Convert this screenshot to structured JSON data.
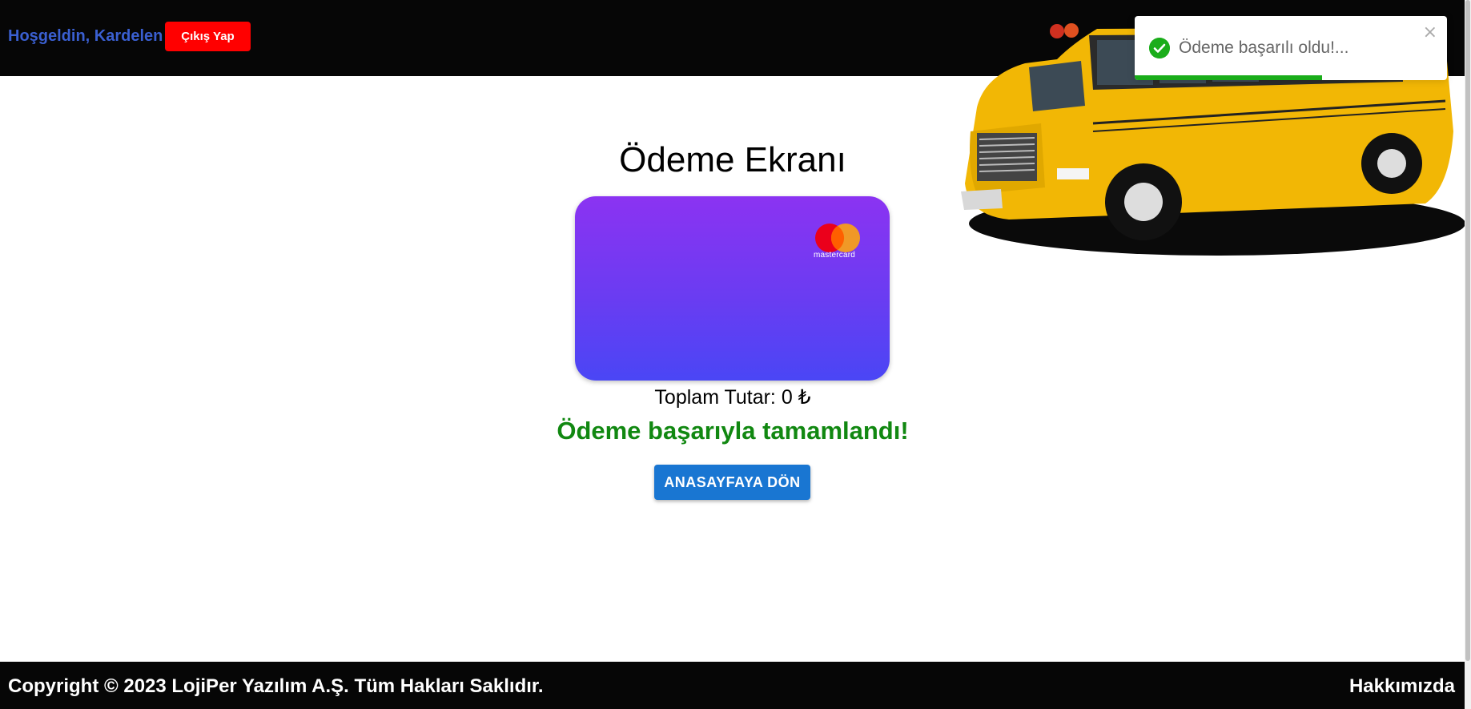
{
  "header": {
    "welcome_text": "Hoşgeldin, Kardelen",
    "logout_label": "Çıkış Yap"
  },
  "toast": {
    "message": "Ödeme başarılı oldu!...",
    "close_symbol": "×",
    "progress": 0.6,
    "icon": "check-circle-icon"
  },
  "main": {
    "title": "Ödeme Ekranı",
    "card_brand": "mastercard",
    "total_text": "Toplam Tutar: 0 ₺",
    "success_text": "Ödeme başarıyla tamamlandı!",
    "home_button_label": "ANASAYFAYA DÖN"
  },
  "footer": {
    "copyright": "Copyright © 2023 LojiPer Yazılım A.Ş. Tüm Hakları Saklıdır.",
    "about_link": "Hakkımızda"
  },
  "colors": {
    "topbar": "#060606",
    "logout_button": "#ff0000",
    "welcome_text": "#3a5fd0",
    "success_green": "#118811",
    "toast_green": "#1aad1a",
    "primary_button": "#1976d2",
    "card_gradient_top": "#8b33f2",
    "card_gradient_bottom": "#4a46f5"
  }
}
